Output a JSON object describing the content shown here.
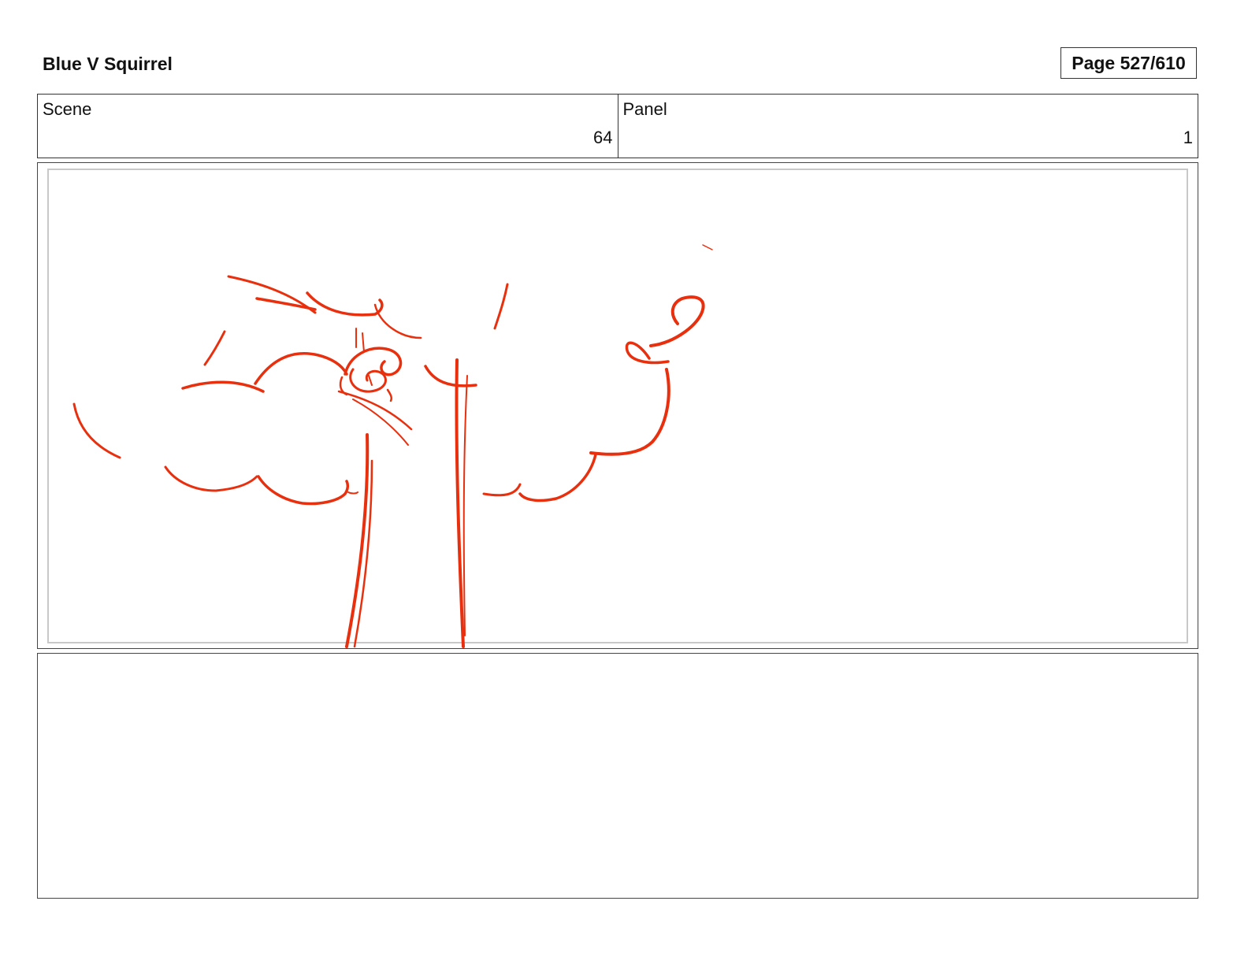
{
  "document": {
    "title": "Blue V Squirrel",
    "page_label": "Page 527/610"
  },
  "info": {
    "scene_label": "Scene",
    "scene_value": "64",
    "panel_label": "Panel",
    "panel_value": "1"
  },
  "sketch": {
    "stroke_color": "#e8300f",
    "subject": "tree-drawing"
  },
  "notes": {
    "text": ""
  }
}
